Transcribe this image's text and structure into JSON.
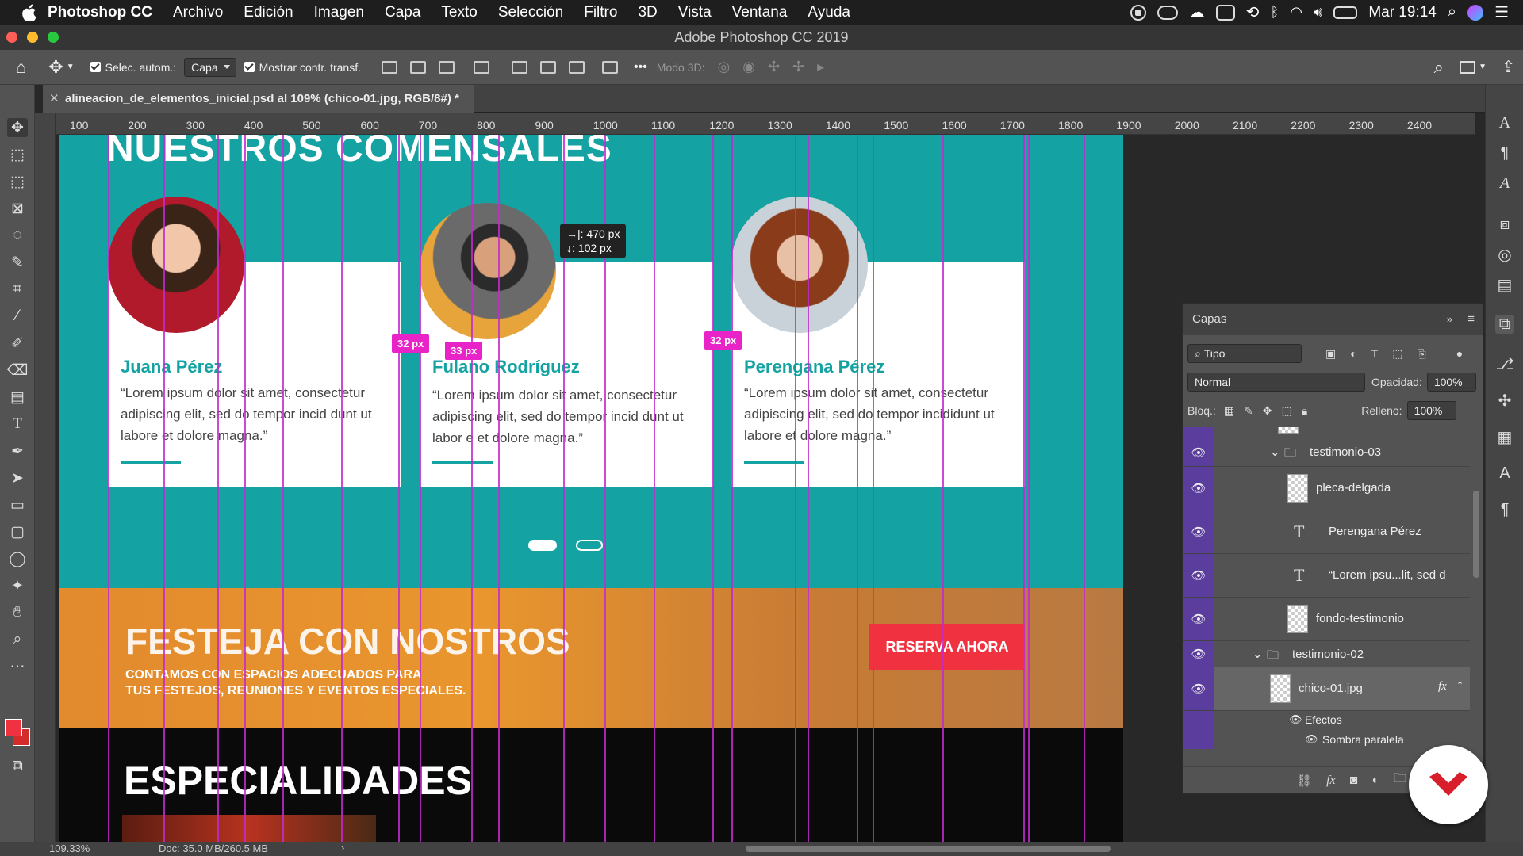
{
  "menubar": {
    "app": "Photoshop CC",
    "items": [
      "Archivo",
      "Edición",
      "Imagen",
      "Capa",
      "Texto",
      "Selección",
      "Filtro",
      "3D",
      "Vista",
      "Ventana",
      "Ayuda"
    ],
    "clock": "Mar 19:14"
  },
  "window": {
    "title": "Adobe Photoshop CC 2019"
  },
  "options": {
    "auto_select_label": "Selec. autom.:",
    "auto_select_value": "Capa",
    "show_transform_label": "Mostrar contr. transf.",
    "mode3d_label": "Modo 3D:",
    "more_label": "•••"
  },
  "document_tab": {
    "title": "alineacion_de_elementos_inicial.psd al 109% (chico-01.jpg, RGB/8#) *",
    "close": "✕"
  },
  "ruler": {
    "ticks": [
      "100",
      "200",
      "300",
      "400",
      "500",
      "600",
      "700",
      "800",
      "900",
      "1000",
      "1100",
      "1200",
      "1300",
      "1400",
      "1500",
      "1600",
      "1700",
      "1800",
      "1900",
      "2000",
      "2100",
      "2200",
      "2300",
      "2400"
    ]
  },
  "page": {
    "section_title": "NUESTROS COMENSALES",
    "testimonials": [
      {
        "name": "Juana Pérez",
        "quote": "“Lorem ipsum dolor sit amet, consectetur adipiscing elit, sed do  tempor incid dunt ut labore et dolore magna.”"
      },
      {
        "name": "Fulano Rodríguez",
        "quote": "“Lorem ipsum dolor sit amet, consectetur adipiscing elit, sed do  tempor incid dunt ut labor e et dolore magna.”"
      },
      {
        "name": "Perengana Pérez",
        "quote": "“Lorem ipsum dolor sit amet, consectetur adipiscing elit, sed do  tempor incididunt ut labore et dolore magna.”"
      }
    ],
    "festeja_title": "FESTEJA CON NOSTROS",
    "festeja_sub1": "CONTAMOS CON ESPACIOS ADECUADOS PARA",
    "festeja_sub2": "TUS FESTEJOS, REUNIONES Y EVENTOS ESPECIALES.",
    "reserve_button": "RESERVA AHORA",
    "especialidades_title": "ESPECIALIDADES"
  },
  "measurements": {
    "gap_left": "32 px",
    "gap_bottom": "33 px",
    "gap_right": "32 px",
    "tooltip_x": "→|: 470 px",
    "tooltip_y": "↓: 102 px"
  },
  "layers_panel": {
    "title": "Capas",
    "filter_kind": "Tipo",
    "blend_mode": "Normal",
    "opacity_label": "Opacidad:",
    "opacity_value": "100%",
    "lock_label": "Bloq.:",
    "fill_label": "Relleno:",
    "fill_value": "100%",
    "layers": [
      {
        "name": "testimonio-03",
        "type": "group"
      },
      {
        "name": "pleca-delgada",
        "type": "smart"
      },
      {
        "name": "Perengana Pérez",
        "type": "text"
      },
      {
        "name": "“Lorem ipsu...lit, sed d",
        "type": "text"
      },
      {
        "name": "fondo-testimonio",
        "type": "smart"
      },
      {
        "name": "testimonio-02",
        "type": "group"
      },
      {
        "name": "chico-01.jpg",
        "type": "smart",
        "fx": "fx"
      }
    ],
    "effects_label": "Efectos",
    "effect_item": "Sombra paralela"
  },
  "status": {
    "zoom": "109.33%",
    "doc": "Doc: 35.0 MB/260.5 MB"
  },
  "colors": {
    "teal": "#14a3a2",
    "orange": "#e9962e",
    "red": "#f0313f",
    "guide": "#c22bcf",
    "measure": "#e823c7"
  }
}
